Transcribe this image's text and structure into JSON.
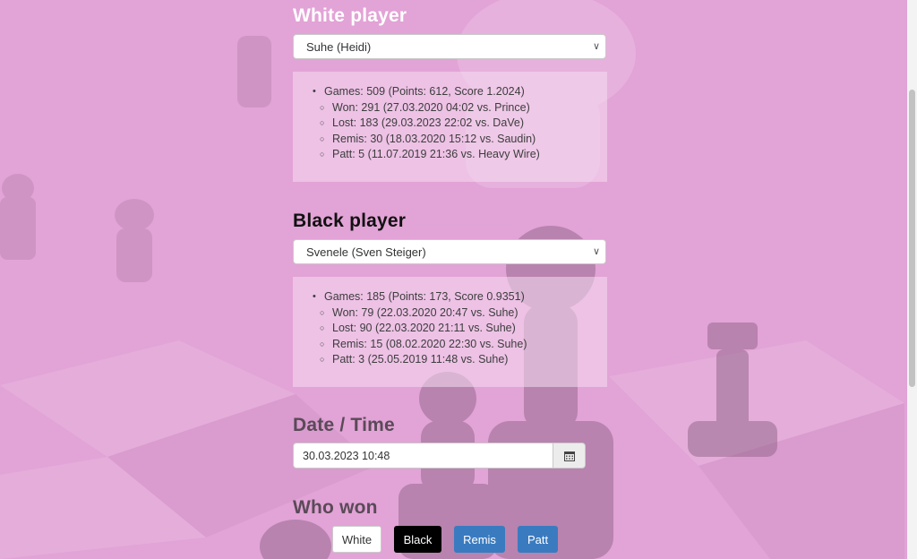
{
  "white": {
    "heading": "White player",
    "selected": "Suhe (Heidi)",
    "stats": {
      "games": "Games: 509 (Points: 612, Score 1.2024)",
      "won": "Won: 291 (27.03.2020 04:02 vs. Prince)",
      "lost": "Lost: 183 (29.03.2023 22:02 vs. DaVe)",
      "remis": "Remis: 30 (18.03.2020 15:12 vs. Saudin)",
      "patt": "Patt: 5 (11.07.2019 21:36 vs. Heavy Wire)"
    }
  },
  "black": {
    "heading": "Black player",
    "selected": "Svenele (Sven Steiger)",
    "stats": {
      "games": "Games: 185 (Points: 173, Score 0.9351)",
      "won": "Won: 79 (22.03.2020 20:47 vs. Suhe)",
      "lost": "Lost: 90 (22.03.2020 21:11 vs. Suhe)",
      "remis": "Remis: 15 (08.02.2020 22:30 vs. Suhe)",
      "patt": "Patt: 3 (25.05.2019 11:48 vs. Suhe)"
    }
  },
  "datetime": {
    "heading": "Date / Time",
    "value": "30.03.2023 10:48",
    "icon": "calendar-icon"
  },
  "winner": {
    "heading": "Who won",
    "buttons": {
      "white": "White",
      "black": "Black",
      "remis": "Remis",
      "patt": "Patt"
    }
  },
  "colors": {
    "background_tint": "#e2a6d8",
    "remis_patt_button": "#3a7bc0",
    "black_button": "#000000"
  }
}
